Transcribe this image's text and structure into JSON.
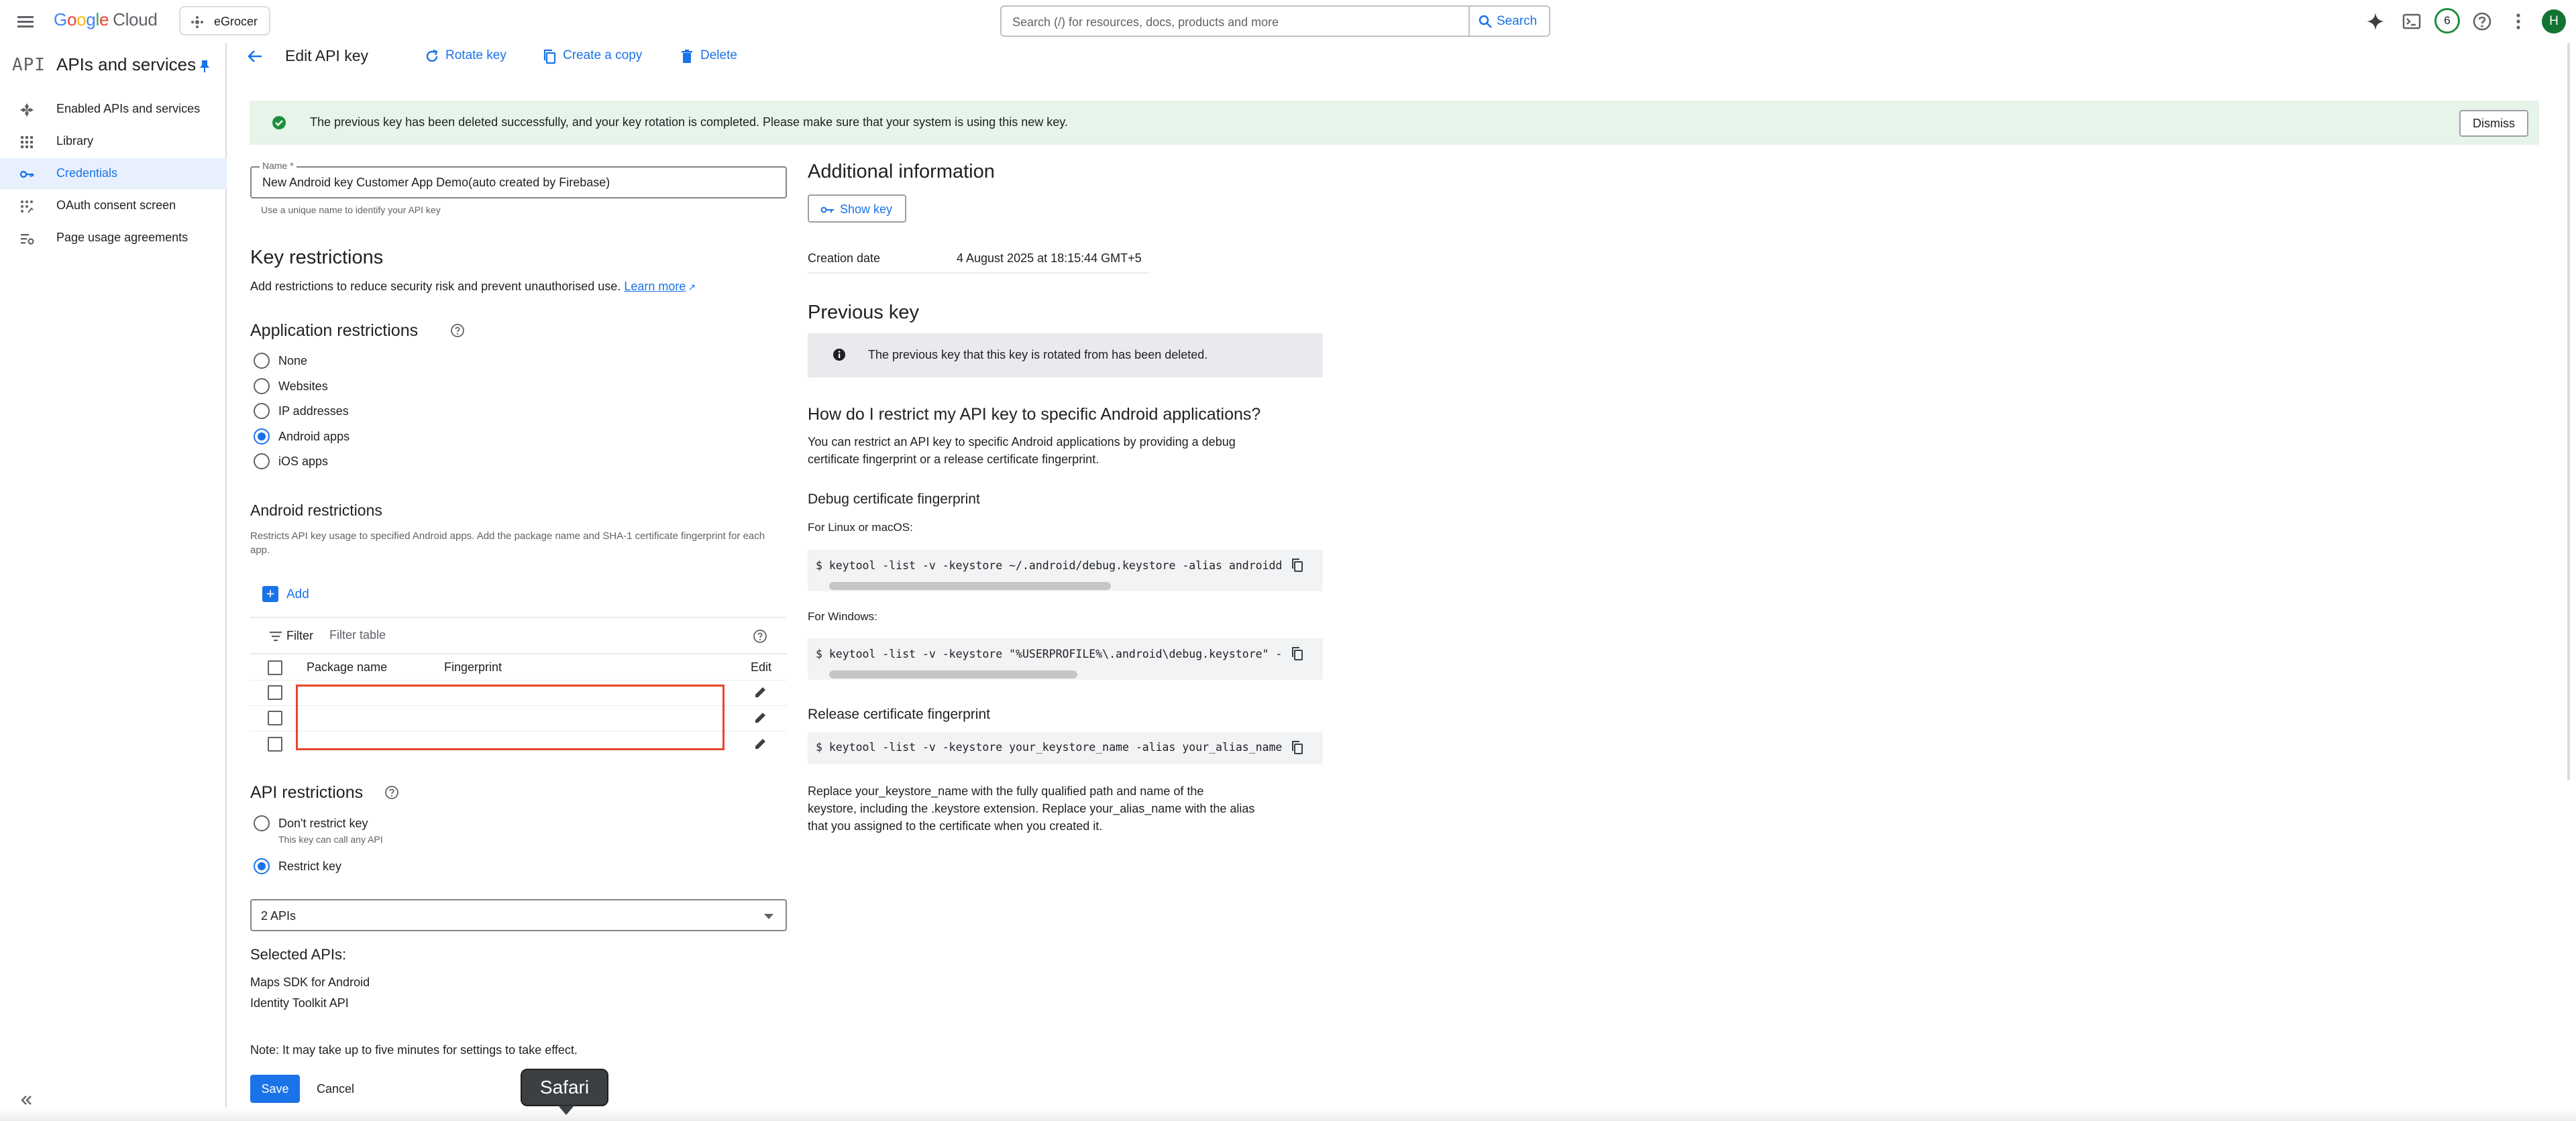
{
  "topbar": {
    "logo_google": "Google",
    "logo_cloud": "Cloud",
    "project": "eGrocer",
    "search_placeholder": "Search (/) for resources, docs, products and more",
    "search_button": "Search",
    "notification_count": "6",
    "avatar_initial": "H"
  },
  "sidebar": {
    "logo_text": "API",
    "title": "APIs and services",
    "items": [
      {
        "label": "Enabled APIs and services",
        "icon": "enabled-apis-icon"
      },
      {
        "label": "Library",
        "icon": "library-icon"
      },
      {
        "label": "Credentials",
        "icon": "key-icon",
        "active": true
      },
      {
        "label": "OAuth consent screen",
        "icon": "oauth-icon"
      },
      {
        "label": "Page usage agreements",
        "icon": "settings-list-icon"
      }
    ]
  },
  "header": {
    "title": "Edit API key",
    "rotate": "Rotate key",
    "copy": "Create a copy",
    "delete": "Delete"
  },
  "banner": {
    "message": "The previous key has been deleted successfully, and your key rotation is completed. Please make sure that your system is using this new key.",
    "dismiss": "Dismiss"
  },
  "form": {
    "name_label": "Name *",
    "name_value": "New Android key Customer App Demo(auto created by Firebase)",
    "name_hint": "Use a unique name to identify your API key",
    "key_restrictions_title": "Key restrictions",
    "key_restrictions_desc": "Add restrictions to reduce security risk and prevent unauthorised use.",
    "learn_more": "Learn more",
    "app_restrictions_title": "Application restrictions",
    "app_options": [
      "None",
      "Websites",
      "IP addresses",
      "Android apps",
      "iOS apps"
    ],
    "app_selected": "Android apps",
    "android_title": "Android restrictions",
    "android_desc": "Restricts API key usage to specified Android apps. Add the package name and SHA-1 certificate fingerprint for each app.",
    "add_label": "Add",
    "filter_label": "Filter",
    "filter_placeholder": "Filter table",
    "table_headers": [
      "Package name",
      "Fingerprint",
      "Edit"
    ],
    "api_restrictions_title": "API restrictions",
    "api_option_1": "Don't restrict key",
    "api_option_1_sub": "This key can call any API",
    "api_option_2": "Restrict key",
    "apis_select": "2 APIs",
    "selected_apis_title": "Selected APIs:",
    "selected_apis": [
      "Maps SDK for Android",
      "Identity Toolkit API"
    ],
    "note": "Note: It may take up to five minutes for settings to take effect.",
    "save": "Save",
    "cancel": "Cancel"
  },
  "right": {
    "additional_title": "Additional information",
    "show_key": "Show key",
    "creation_label": "Creation date",
    "creation_value": "4 August 2025 at 18:15:44 GMT+5",
    "previous_key_title": "Previous key",
    "previous_key_notice": "The previous key that this key is rotated from has been deleted.",
    "howto_title": "How do I restrict my API key to specific Android applications?",
    "howto_line1": "You can restrict an API key to specific Android applications by providing a debug",
    "howto_line2": "certificate fingerprint or a release certificate fingerprint.",
    "debug_title": "Debug certificate fingerprint",
    "linux_label": "For Linux or macOS:",
    "linux_cmd": "$  keytool -list -v -keystore ~/.android/debug.keystore -alias androiddebugkey",
    "windows_label": "For Windows:",
    "windows_cmd": "$  keytool -list -v -keystore \"%USERPROFILE%\\.android\\debug.keystore\" -alias androiddebugkey",
    "release_title": "Release certificate fingerprint",
    "release_cmd": "$  keytool -list -v -keystore your_keystore_name -alias your_alias_name",
    "replace_line1": "Replace your_keystore_name with the fully qualified path and name of the",
    "replace_line2": "keystore, including the .keystore extension. Replace your_alias_name with the alias",
    "replace_line3": "that you assigned to the certificate when you created it."
  },
  "tooltip": "Safari",
  "colors": {
    "accent": "#1a73e8",
    "success_bg": "#e6f4ea",
    "highlight": "#e8452c"
  }
}
